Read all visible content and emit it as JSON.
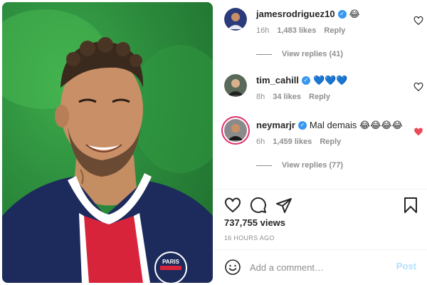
{
  "comments": [
    {
      "username": "jamesrodriguez10",
      "text": "😂",
      "time": "16h",
      "likes": "1,483 likes",
      "reply": "Reply",
      "view_replies": "View replies (41)",
      "liked": false
    },
    {
      "username": "tim_cahill",
      "text": "💙💙💙",
      "time": "8h",
      "likes": "34 likes",
      "reply": "Reply",
      "liked": false
    },
    {
      "username": "neymarjr",
      "text": "Mal demais 😂😂😂😂",
      "time": "6h",
      "likes": "1,459 likes",
      "reply": "Reply",
      "view_replies": "View replies (77)",
      "liked": true
    }
  ],
  "post": {
    "views": "737,755 views",
    "time_ago": "16 HOURS AGO",
    "jersey_text": "PARIS"
  },
  "add_comment": {
    "placeholder": "Add a comment…",
    "post_label": "Post"
  },
  "colors": {
    "heart_liked": "#ed4956",
    "verified": "#3897f0",
    "post_disabled": "#b2dffc"
  },
  "icons": {
    "like": "heart-outline-icon",
    "comment": "comment-bubble-icon",
    "share": "paper-plane-icon",
    "save": "bookmark-icon",
    "emoji": "smiley-icon"
  }
}
